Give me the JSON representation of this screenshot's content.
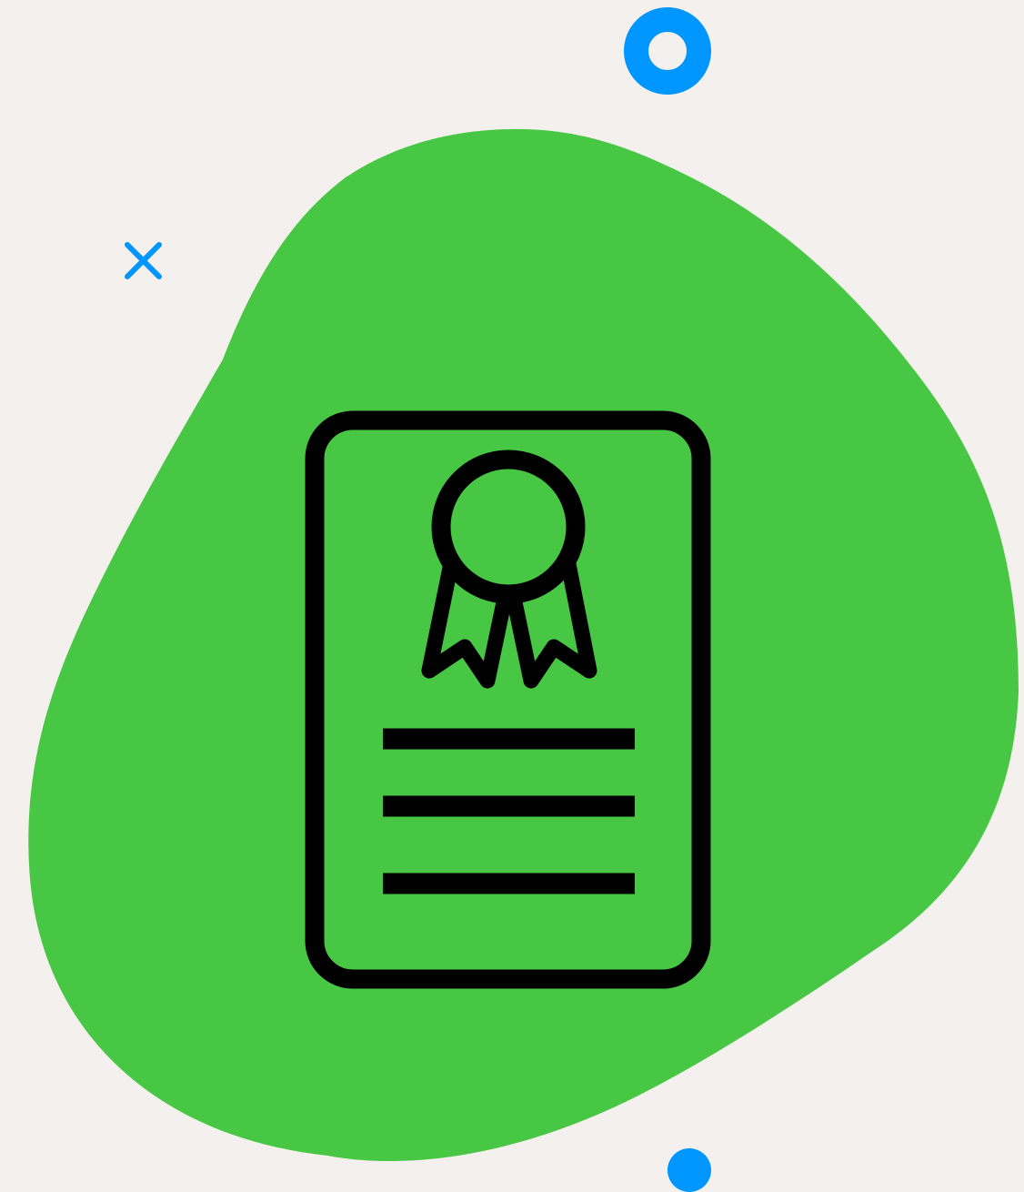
{
  "colors": {
    "background": "#f3f0ed",
    "blob": "#47c744",
    "accent": "#0096ff",
    "icon": "#000000"
  },
  "icons": {
    "main": "certificate-icon",
    "ribbon": "award-ribbon-icon",
    "text_lines": "document-lines",
    "decor_ring": "ring-icon",
    "decor_cross": "close-icon",
    "decor_dot": "dot-icon"
  }
}
